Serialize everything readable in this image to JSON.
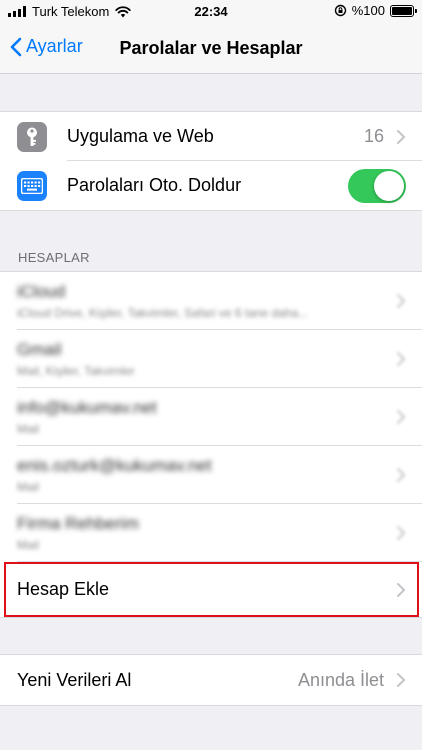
{
  "status_bar": {
    "carrier": "Turk Telekom",
    "time": "22:34",
    "battery": "%100"
  },
  "nav": {
    "back_label": "Ayarlar",
    "title": "Parolalar ve Hesaplar"
  },
  "top_group": {
    "apps_web": {
      "label": "Uygulama ve Web",
      "count": "16",
      "icon": "key-icon",
      "icon_color": "#8e8e93"
    },
    "autofill": {
      "label": "Parolaları Oto. Doldur",
      "toggle_on": true,
      "icon": "keyboard-icon",
      "icon_color": "#1a82fb",
      "toggle_color": "#34c759"
    }
  },
  "accounts": {
    "header": "HESAPLAR",
    "items": [
      {
        "name": "iCloud",
        "detail": "iCloud Drive, Kişiler, Takvimler, Safari ve 6 tane daha..."
      },
      {
        "name": "Gmail",
        "detail": "Mail, Kişiler, Takvimler"
      },
      {
        "name": "info@kukumav.net",
        "detail": "Mail"
      },
      {
        "name": "enis.ozturk@kukumav.net",
        "detail": "Mail"
      },
      {
        "name": "Firma Rehberim",
        "detail": "Mail"
      }
    ],
    "add_account": "Hesap Ekle"
  },
  "fetch": {
    "label": "Yeni Verileri Al",
    "value": "Anında İlet"
  },
  "colors": {
    "accent": "#007aff",
    "highlight": "#e0101a"
  }
}
